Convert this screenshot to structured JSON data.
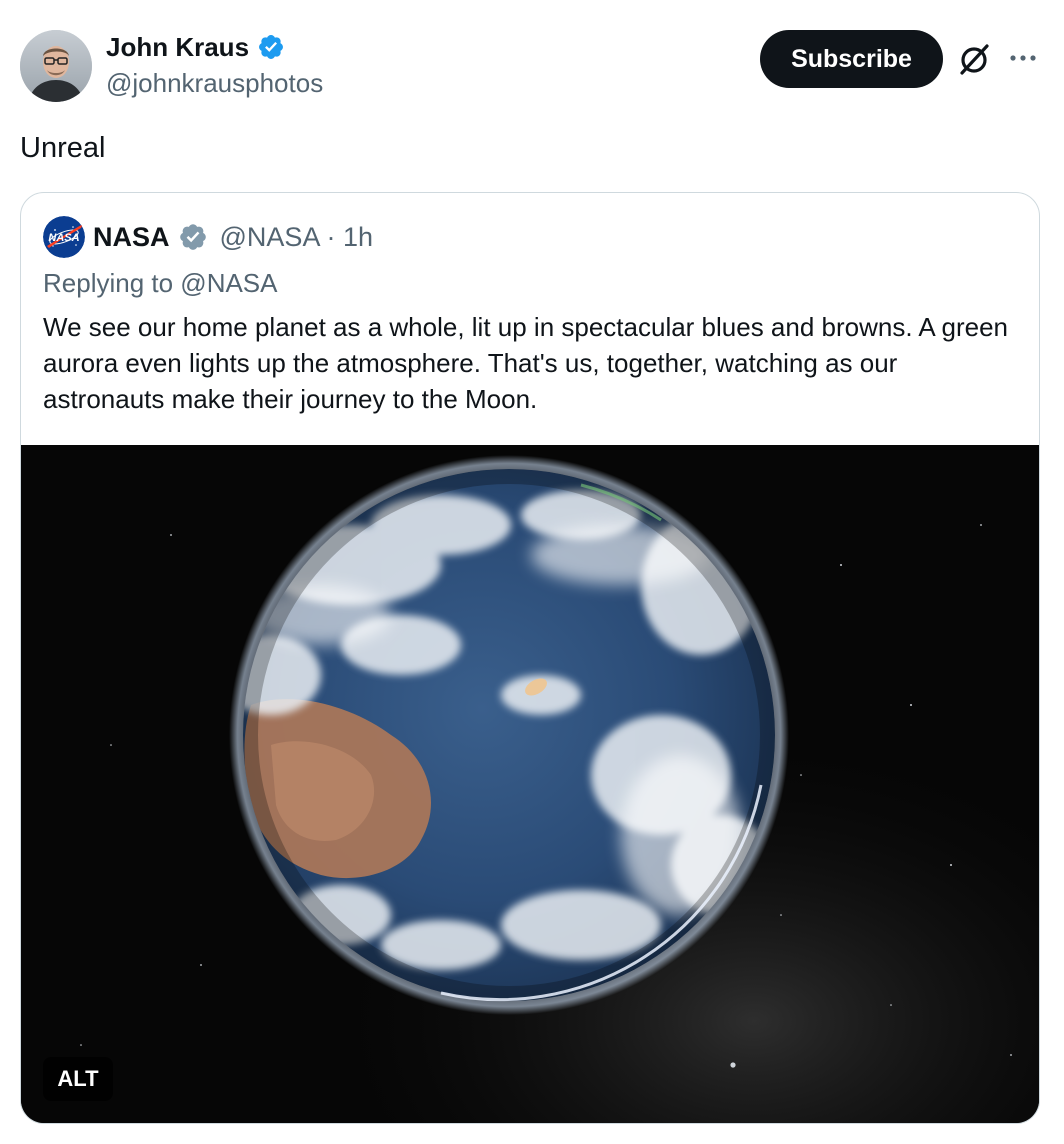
{
  "author": {
    "name": "John Kraus",
    "handle": "@johnkrausphotos",
    "verified_color": "#1d9bf0"
  },
  "actions": {
    "subscribe_label": "Subscribe",
    "grok_icon": "grok-icon",
    "more_icon": "more-icon"
  },
  "tweet": {
    "text": "Unreal"
  },
  "quoted": {
    "name": "NASA",
    "handle": "@NASA",
    "time": "1h",
    "handle_time": "@NASA · 1h",
    "verified_color": "#829aab",
    "replying_to": "Replying to @NASA",
    "body": "We see our home planet as a whole, lit up in spectacular blues and browns. A green aurora even lights up the atmosphere. That's us, together, watching as our astronauts make their journey to the Moon.",
    "media": {
      "alt_label": "ALT"
    }
  },
  "colors": {
    "text_primary": "#0f1419",
    "text_secondary": "#536471",
    "border": "#cfd9de",
    "subscribe_bg": "#0f1419"
  }
}
